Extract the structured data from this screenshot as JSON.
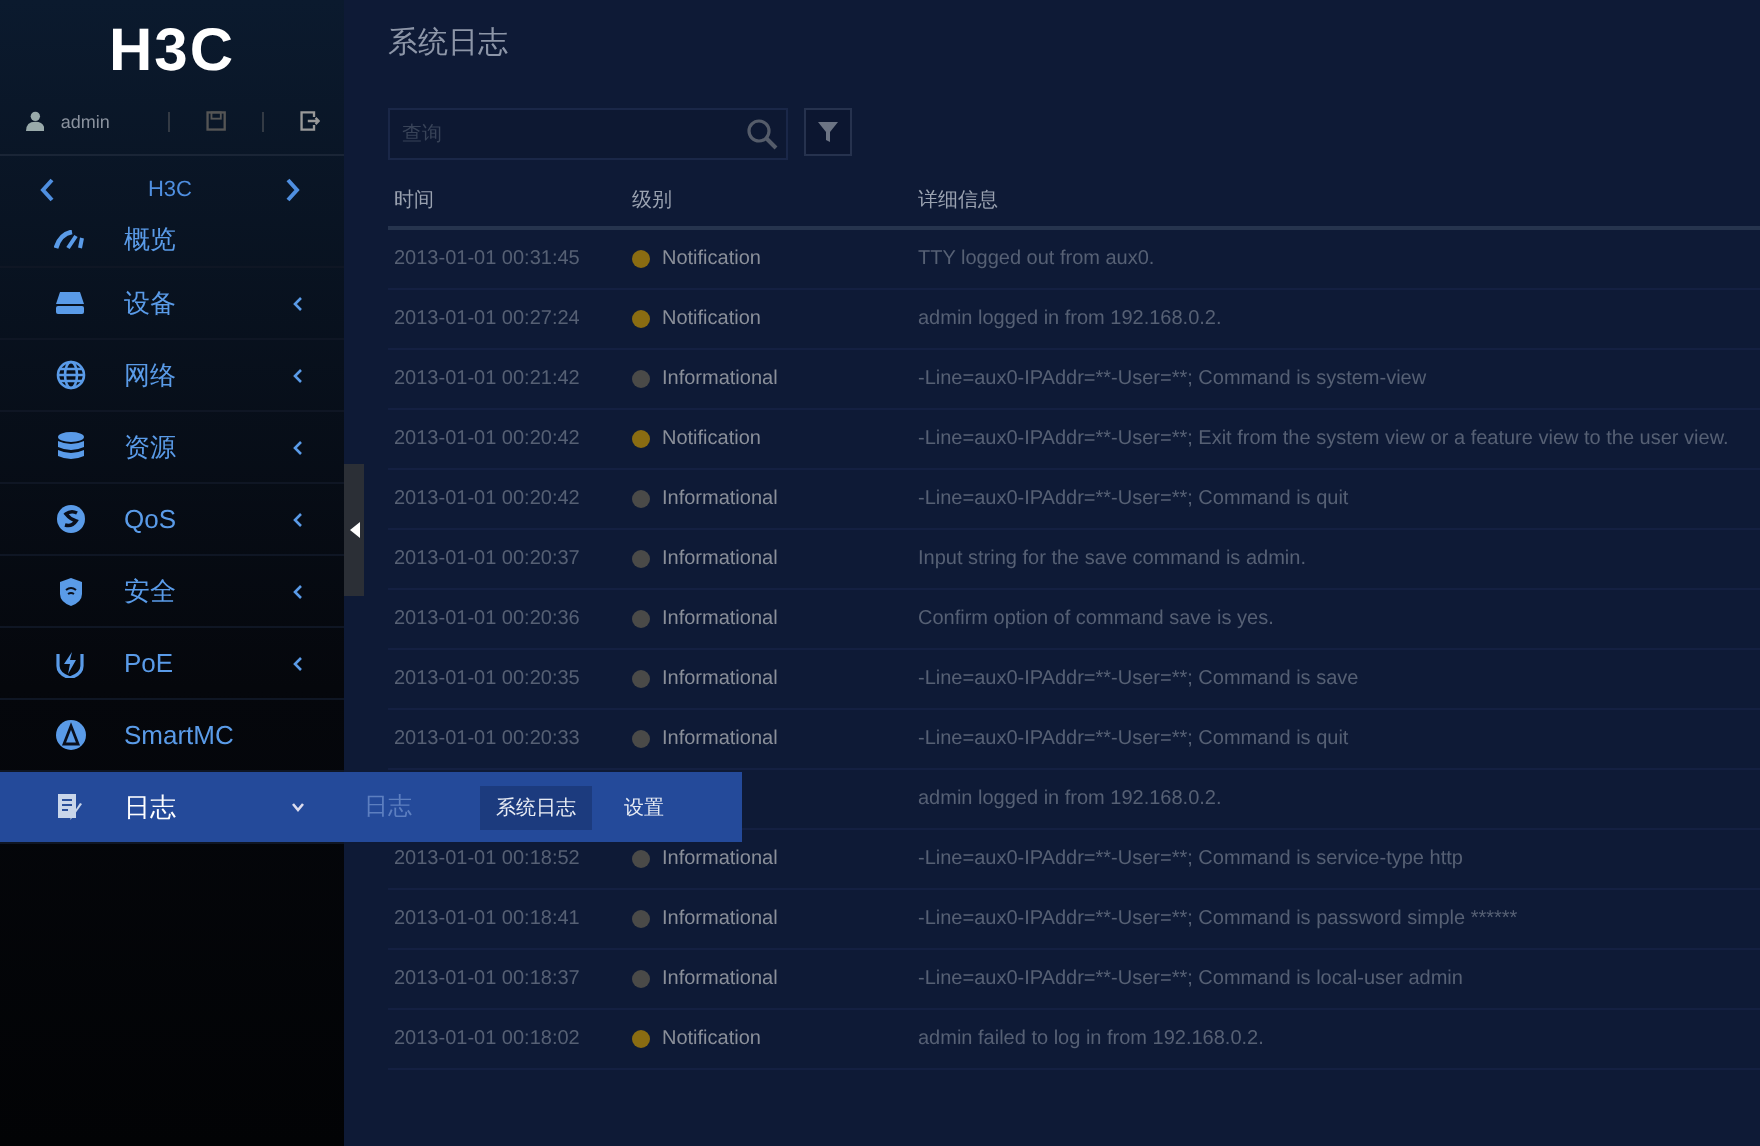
{
  "sidebar": {
    "logo": "H3C",
    "user": "admin",
    "device": "H3C",
    "items": [
      {
        "label": "概览",
        "expandable": false,
        "selected": false
      },
      {
        "label": "设备",
        "expandable": true,
        "selected": false
      },
      {
        "label": "网络",
        "expandable": true,
        "selected": false
      },
      {
        "label": "资源",
        "expandable": true,
        "selected": false
      },
      {
        "label": "QoS",
        "expandable": true,
        "selected": false
      },
      {
        "label": "安全",
        "expandable": true,
        "selected": false
      },
      {
        "label": "PoE",
        "expandable": true,
        "selected": false
      },
      {
        "label": "SmartMC",
        "expandable": false,
        "selected": false
      },
      {
        "label": "日志",
        "expandable": true,
        "selected": true
      }
    ]
  },
  "flyout": {
    "title": "日志",
    "items": [
      {
        "label": "系统日志",
        "selected": true
      },
      {
        "label": "设置",
        "selected": false
      }
    ]
  },
  "page": {
    "title": "系统日志",
    "search": {
      "placeholder": "查询"
    }
  },
  "table": {
    "columns": [
      "时间",
      "级别",
      "详细信息"
    ],
    "rows": [
      {
        "time": "2013-01-01 00:31:45",
        "level": "Notification",
        "message": "TTY logged out from aux0."
      },
      {
        "time": "2013-01-01 00:27:24",
        "level": "Notification",
        "message": "admin logged in from 192.168.0.2."
      },
      {
        "time": "2013-01-01 00:21:42",
        "level": "Informational",
        "message": "-Line=aux0-IPAddr=**-User=**; Command is system-view"
      },
      {
        "time": "2013-01-01 00:20:42",
        "level": "Notification",
        "message": "-Line=aux0-IPAddr=**-User=**; Exit from the system view or a feature view to the user view."
      },
      {
        "time": "2013-01-01 00:20:42",
        "level": "Informational",
        "message": "-Line=aux0-IPAddr=**-User=**; Command is quit"
      },
      {
        "time": "2013-01-01 00:20:37",
        "level": "Informational",
        "message": "Input string for the save command is admin."
      },
      {
        "time": "2013-01-01 00:20:36",
        "level": "Informational",
        "message": "Confirm option of command save is yes."
      },
      {
        "time": "2013-01-01 00:20:35",
        "level": "Informational",
        "message": "-Line=aux0-IPAddr=**-User=**; Command is save"
      },
      {
        "time": "2013-01-01 00:20:33",
        "level": "Informational",
        "message": "-Line=aux0-IPAddr=**-User=**; Command is quit"
      },
      {
        "message": "admin logged in from 192.168.0.2."
      },
      {
        "time": "2013-01-01 00:18:52",
        "level": "Informational",
        "message": "-Line=aux0-IPAddr=**-User=**; Command is service-type http"
      },
      {
        "time": "2013-01-01 00:18:41",
        "level": "Informational",
        "message": "-Line=aux0-IPAddr=**-User=**; Command is password simple ******"
      },
      {
        "time": "2013-01-01 00:18:37",
        "level": "Informational",
        "message": "-Line=aux0-IPAddr=**-User=**; Command is local-user admin"
      },
      {
        "time": "2013-01-01 00:18:02",
        "level": "Notification",
        "message": "admin failed to log in from 192.168.0.2."
      }
    ]
  }
}
